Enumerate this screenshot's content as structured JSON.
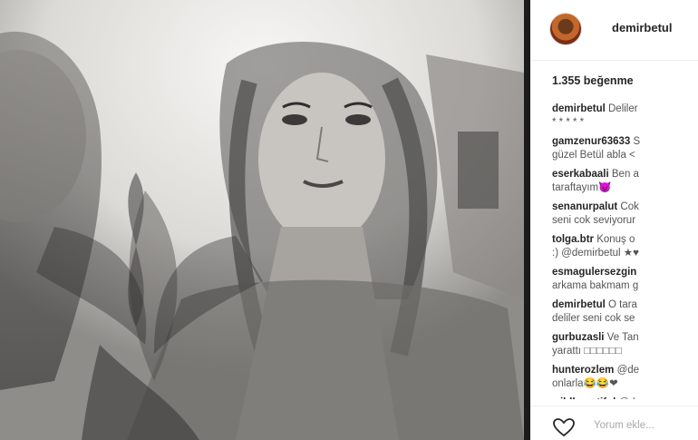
{
  "post": {
    "username": "demirbetul",
    "likes": "1.355 beğenme",
    "photo": {
      "description_icon": "selfie-mirror-photo"
    }
  },
  "comments": [
    {
      "user": "demirbetul",
      "text": "Deliler",
      "line2": "* * * * *"
    },
    {
      "user": "gamzenur63633",
      "text": "S",
      "line2": "güzel Betül abla <"
    },
    {
      "user": "eserkabaali",
      "text": "Ben a",
      "line2": "taraftayım😈"
    },
    {
      "user": "senanurpalut",
      "text": "Cok",
      "line2": "seni cok seviyorur"
    },
    {
      "user": "tolga.btr",
      "text": "Konuş o",
      "line2": ":) @demirbetul ★♥"
    },
    {
      "user": "esmagulersezgin",
      "text": "",
      "line2": "arkama bakmam g"
    },
    {
      "user": "demirbetul",
      "text": "O tara",
      "line2": "deliler seni cok se"
    },
    {
      "user": "gurbuzasli",
      "text": "Ve Tan",
      "line2": "yarattı □□□□□□"
    },
    {
      "user": "hunterozlem",
      "text": "@de",
      "line2": "onlarla😂😂❤"
    },
    {
      "user": "wildbeautiful",
      "text": "@d",
      "line2": ""
    }
  ],
  "footer": {
    "comment_placeholder": "Yorum ekle...",
    "heart_icon": "heart-outline-icon"
  },
  "colors": {
    "divider": "#1b1b1b",
    "text": "#262626",
    "placeholder": "#a8a8a8"
  }
}
